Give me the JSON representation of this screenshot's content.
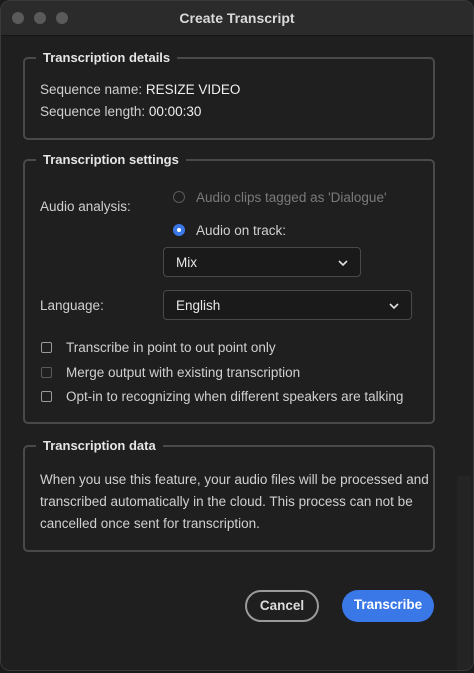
{
  "window": {
    "title": "Create Transcript"
  },
  "details": {
    "heading": "Transcription details",
    "sequence_name_label": "Sequence name:",
    "sequence_name_value": "RESIZE VIDEO",
    "sequence_length_label": "Sequence length:",
    "sequence_length_value": "00:00:30"
  },
  "settings": {
    "heading": "Transcription settings",
    "audio_analysis_label": "Audio analysis:",
    "radio_dialogue": "Audio clips tagged as 'Dialogue'",
    "radio_track": "Audio on track:",
    "track_select_value": "Mix",
    "language_label": "Language:",
    "language_value": "English",
    "checkbox_inout": "Transcribe in point to out point only",
    "checkbox_merge": "Merge output with existing transcription",
    "checkbox_speakers": "Opt-in to recognizing when different speakers are talking"
  },
  "data_section": {
    "heading": "Transcription data",
    "line1": "When you use this feature, your audio files will be processed and",
    "line2": "transcribed automatically in the cloud. This process can not be",
    "line3": "cancelled once sent for transcription."
  },
  "buttons": {
    "cancel": "Cancel",
    "transcribe": "Transcribe"
  },
  "colors": {
    "accent": "#3b78e7",
    "background": "#1f1f1f"
  }
}
